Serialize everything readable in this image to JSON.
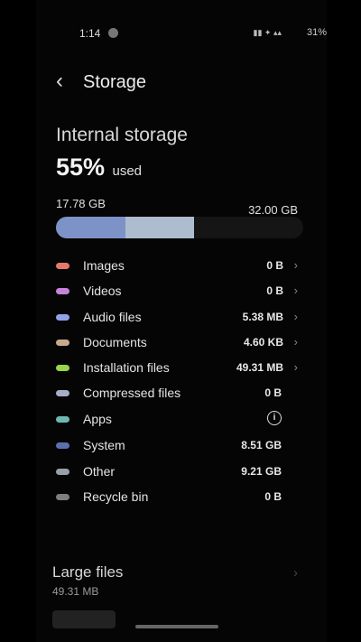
{
  "status_bar": {
    "time": "1:14",
    "battery": "31%"
  },
  "header": {
    "title": "Storage",
    "back_icon": "chevron-left-icon"
  },
  "internal_storage": {
    "label": "Internal storage",
    "percent_used": "55%",
    "used_label": "used",
    "used_size": "17.78 GB",
    "total_size": "32.00 GB",
    "bar_segments": [
      {
        "name": "system-apps",
        "fraction": 0.28,
        "color": "#7d93c8"
      },
      {
        "name": "other",
        "fraction": 0.28,
        "color": "#aebccf"
      }
    ]
  },
  "categories": [
    {
      "label": "Images",
      "value": "0 B",
      "color": "#e5786d",
      "chevron": true
    },
    {
      "label": "Videos",
      "value": "0 B",
      "color": "#c783d9",
      "chevron": true
    },
    {
      "label": "Audio files",
      "value": "5.38 MB",
      "color": "#8fa3e6",
      "chevron": true
    },
    {
      "label": "Documents",
      "value": "4.60 KB",
      "color": "#c9a98c",
      "chevron": true
    },
    {
      "label": "Installation files",
      "value": "49.31 MB",
      "color": "#9ad44b",
      "chevron": true
    },
    {
      "label": "Compressed files",
      "value": "0 B",
      "color": "#a7aec8",
      "chevron": false
    },
    {
      "label": "Apps",
      "value": "",
      "color": "#6fb7b2",
      "chevron": false,
      "info": "i"
    },
    {
      "label": "System",
      "value": "8.51 GB",
      "color": "#5c6fa8",
      "chevron": false
    },
    {
      "label": "Other",
      "value": "9.21 GB",
      "color": "#9aa0a8",
      "chevron": false
    },
    {
      "label": "Recycle bin",
      "value": "0 B",
      "color": "#7e7e7e",
      "chevron": false
    }
  ],
  "large_files": {
    "title": "Large files",
    "size": "49.31 MB"
  }
}
